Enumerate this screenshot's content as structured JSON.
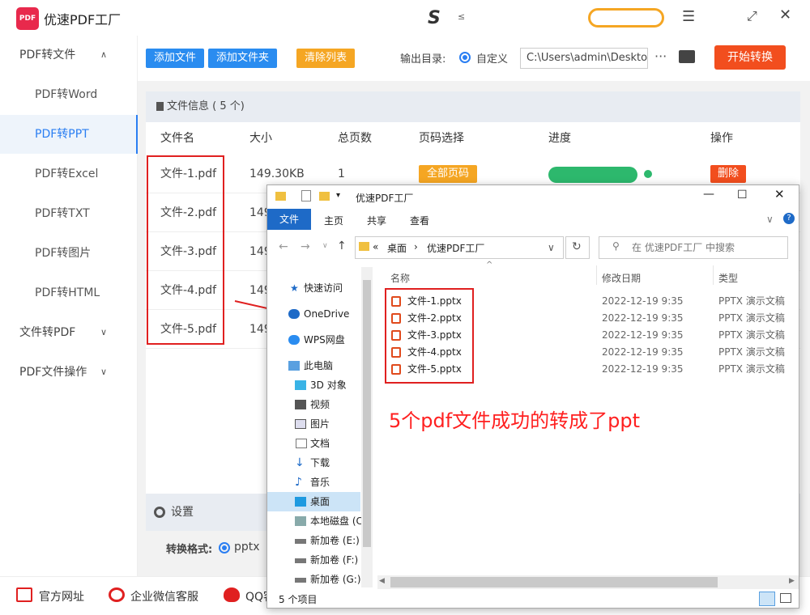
{
  "app": {
    "title": "优速PDF工厂",
    "logo_text": "PDF",
    "brand_letter": "S",
    "brand_small": "≤"
  },
  "sidebar": {
    "items": [
      {
        "label": "PDF转文件"
      },
      {
        "label": "PDF转Word"
      },
      {
        "label": "PDF转PPT"
      },
      {
        "label": "PDF转Excel"
      },
      {
        "label": "PDF转TXT"
      },
      {
        "label": "PDF转图片"
      },
      {
        "label": "PDF转HTML"
      },
      {
        "label": "文件转PDF"
      },
      {
        "label": "PDF文件操作"
      }
    ]
  },
  "toolbar": {
    "add_file": "添加文件",
    "add_folder": "添加文件夹",
    "clear_list": "清除列表",
    "output_label": "输出目录:",
    "custom_label": "自定义",
    "output_path": "C:\\Users\\admin\\Deskto",
    "more": "···",
    "start": "开始转换"
  },
  "file_panel": {
    "header": "文件信息 ( 5 个)",
    "columns": [
      "文件名",
      "大小",
      "总页数",
      "页码选择",
      "进度",
      "操作"
    ],
    "rows": [
      {
        "name": "文件-1.pdf",
        "size": "149.30KB",
        "pages": "1"
      },
      {
        "name": "文件-2.pdf",
        "size": "149"
      },
      {
        "name": "文件-3.pdf",
        "size": "149"
      },
      {
        "name": "文件-4.pdf",
        "size": "149"
      },
      {
        "name": "文件-5.pdf",
        "size": "149"
      }
    ],
    "all_pages": "全部页码",
    "progress_pct": 100,
    "delete": "删除"
  },
  "settings": {
    "title": "设置",
    "format_label": "转换格式:",
    "format_value": "pptx"
  },
  "footer": {
    "website": "官方网址",
    "wechat": "企业微信客服",
    "qq": "QQ客"
  },
  "explorer": {
    "title": "优速PDF工厂",
    "ribbon": [
      "文件",
      "主页",
      "共享",
      "查看"
    ],
    "breadcrumb": [
      "«",
      "桌面",
      "›",
      "优速PDF工厂"
    ],
    "search_placeholder": "在 优速PDF工厂 中搜索",
    "nav": [
      "快速访问",
      "OneDrive",
      "WPS网盘",
      "此电脑",
      "3D 对象",
      "视频",
      "图片",
      "文档",
      "下载",
      "音乐",
      "桌面",
      "本地磁盘 (C",
      "新加卷 (E:)",
      "新加卷 (F:)",
      "新加卷 (G:)"
    ],
    "columns": [
      "名称",
      "修改日期",
      "类型"
    ],
    "files": [
      {
        "name": "文件-1.pptx",
        "date": "2022-12-19 9:35",
        "type": "PPTX 演示文稿"
      },
      {
        "name": "文件-2.pptx",
        "date": "2022-12-19 9:35",
        "type": "PPTX 演示文稿"
      },
      {
        "name": "文件-3.pptx",
        "date": "2022-12-19 9:35",
        "type": "PPTX 演示文稿"
      },
      {
        "name": "文件-4.pptx",
        "date": "2022-12-19 9:35",
        "type": "PPTX 演示文稿"
      },
      {
        "name": "文件-5.pptx",
        "date": "2022-12-19 9:35",
        "type": "PPTX 演示文稿"
      }
    ],
    "status": "5 个项目"
  },
  "annotation": {
    "caption": "5个pdf文件成功的转成了ppt"
  },
  "colors": {
    "accent": "#2a7ef2",
    "orange": "#f5a623",
    "red": "#f24e1e",
    "green": "#2db86d",
    "annot_red": "#e02020"
  }
}
